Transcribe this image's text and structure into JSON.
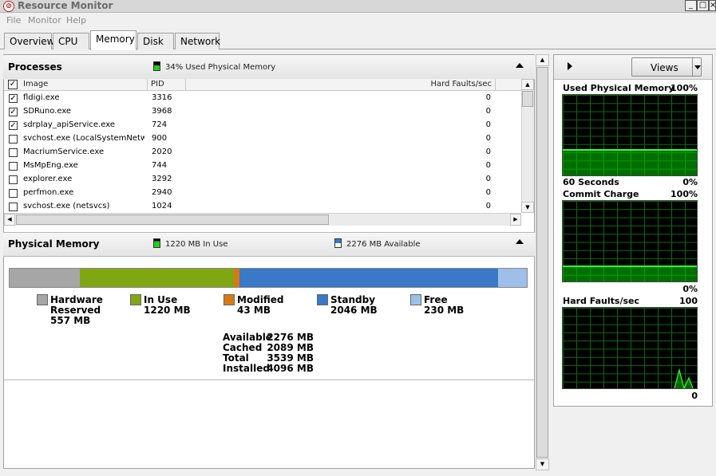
{
  "window": {
    "title": "Resource Monitor",
    "icon": "resource-monitor-icon",
    "controls": [
      "_",
      "□",
      "×"
    ]
  },
  "menu": [
    "File",
    "Monitor",
    "Help"
  ],
  "tabs": [
    "Overview",
    "CPU",
    "Memory",
    "Disk",
    "Network"
  ],
  "active_tab": "Memory",
  "processes": {
    "title": "Processes",
    "info": "34% Used Physical Memory",
    "columns": {
      "image": "Image",
      "pid": "PID",
      "faults": "Hard Faults/sec"
    },
    "rows": [
      {
        "checked": true,
        "image": "fldigi.exe",
        "pid": "3316",
        "faults": "0"
      },
      {
        "checked": true,
        "image": "SDRuno.exe",
        "pid": "3968",
        "faults": "0"
      },
      {
        "checked": true,
        "image": "sdrplay_apiService.exe",
        "pid": "724",
        "faults": "0"
      },
      {
        "checked": false,
        "image": "svchost.exe (LocalSystemNetwo...",
        "pid": "900",
        "faults": "0"
      },
      {
        "checked": false,
        "image": "MacriumService.exe",
        "pid": "2020",
        "faults": "0"
      },
      {
        "checked": false,
        "image": "MsMpEng.exe",
        "pid": "744",
        "faults": "0"
      },
      {
        "checked": false,
        "image": "explorer.exe",
        "pid": "3292",
        "faults": "0"
      },
      {
        "checked": false,
        "image": "perfmon.exe",
        "pid": "2940",
        "faults": "0"
      },
      {
        "checked": false,
        "image": "svchost.exe (netsvcs)",
        "pid": "1024",
        "faults": "0"
      }
    ]
  },
  "physical_memory": {
    "title": "Physical Memory",
    "in_use_info": "1220 MB In Use",
    "available_info": "2276 MB Available",
    "segments": [
      {
        "name": "Hardware Reserved",
        "label1": "Hardware",
        "label2": "Reserved",
        "value": "557 MB",
        "mb": 557,
        "color": "#a6a6a6"
      },
      {
        "name": "In Use",
        "label1": "In Use",
        "label2": "",
        "value": "1220 MB",
        "mb": 1220,
        "color": "#80a612"
      },
      {
        "name": "Modified",
        "label1": "Modified",
        "label2": "",
        "value": "43 MB",
        "mb": 43,
        "color": "#d67a14"
      },
      {
        "name": "Standby",
        "label1": "Standby",
        "label2": "",
        "value": "2046 MB",
        "mb": 2046,
        "color": "#3a78c8"
      },
      {
        "name": "Free",
        "label1": "Free",
        "label2": "",
        "value": "230 MB",
        "mb": 230,
        "color": "#9dc0ea"
      }
    ],
    "stats": [
      {
        "label": "Available",
        "value": "2276 MB"
      },
      {
        "label": "Cached",
        "value": "2089 MB"
      },
      {
        "label": "Total",
        "value": "3539 MB"
      },
      {
        "label": "Installed",
        "value": "4096 MB"
      }
    ]
  },
  "right_panel": {
    "views_label": "Views",
    "graphs": [
      {
        "title": "Used Physical Memory",
        "max": "100%",
        "min": "0%",
        "time": "60 Seconds"
      },
      {
        "title": "Commit Charge",
        "max": "100%",
        "min": "0%",
        "time": ""
      },
      {
        "title": "Hard Faults/sec",
        "max": "100",
        "min": "0",
        "time": ""
      }
    ]
  }
}
